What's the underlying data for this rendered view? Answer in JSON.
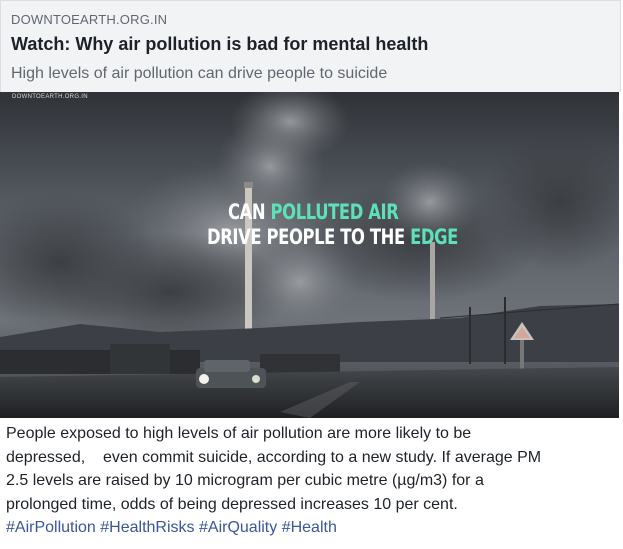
{
  "link_preview": {
    "domain": "DOWNTOEARTH.ORG.IN",
    "headline": "Watch: Why air pollution is bad for mental health",
    "subline": "High levels of air pollution can drive people to suicide"
  },
  "video": {
    "corner_tag": "DOWNTOEARTH.ORG.IN",
    "overlay_line1_a": "CAN ",
    "overlay_line1_b": "POLLUTED AIR",
    "overlay_line2_a": "DRIVE PEOPLE TO THE ",
    "overlay_line2_b": "EDGE",
    "accent_color": "#5ee0b8"
  },
  "post": {
    "line1": "People exposed to high levels of air pollution are more likely to be",
    "line2": "depressed,    even commit suicide, according to a new study. If average PM",
    "line3": "2.5 levels are raised by 10 microgram per cubic metre (µg/m3) for a",
    "line4": "prolonged time, odds of being depressed increases 10 per cent.",
    "hashtags": [
      "#AirPollution",
      "#HealthRisks",
      "#AirQuality",
      "#Health"
    ],
    "hashtag_color": "#385898"
  }
}
